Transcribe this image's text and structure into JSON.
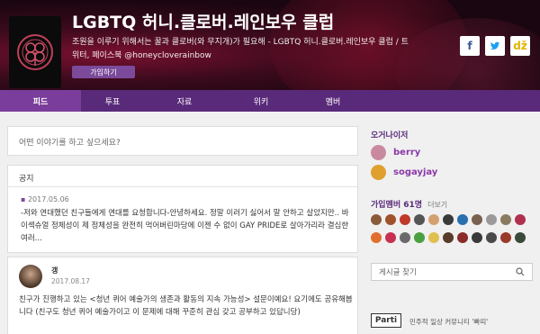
{
  "header": {
    "title": "LGBTQ 허니.클로버.레인보우 클럽",
    "description": "조원을 이루기 위해서는 꿀과 클로버(와 무지개)가 필요해 - LGBTQ 허니.클로버.레인보우 클럽 / 트위터, 페이스북 @honeycloverainbow",
    "join_label": "가입하기",
    "share_buttons": [
      {
        "name": "facebook",
        "glyph": "f"
      },
      {
        "name": "twitter",
        "glyph": "t"
      },
      {
        "name": "kakaostory",
        "glyph": "ǆ"
      }
    ]
  },
  "tabs": [
    {
      "label": "피드",
      "active": true
    },
    {
      "label": "투표",
      "active": false
    },
    {
      "label": "자료",
      "active": false
    },
    {
      "label": "위키",
      "active": false
    },
    {
      "label": "멤버",
      "active": false
    }
  ],
  "compose": {
    "placeholder": "어떤 이야기를 하고 싶으세요?"
  },
  "notice": {
    "heading": "공지",
    "date": "2017.05.06",
    "text": "-저와 연대했던 친구들에게 연대를 요청합니다-안녕하세요. 정말 이러기 싫어서 말 안하고 살았지만.. 바이섹슈얼 정체성이 제 정체성을 완전히 먹어버린마당에 이젠 수 없이 GAY PRIDE로 살아가리라 결심한 여러..."
  },
  "post": {
    "author": "갱",
    "date": "2017.08.17",
    "text": "친구가 진행하고 있는 <청년 퀴어 예술가의 생존과 활동의 지속 가능성> 설문이예요! 요기에도 공유해봅니다 (친구도 청년 퀴어 예술가이고 이 문제에 대해 꾸준히 관심 갖고 공부하고 있답니당)"
  },
  "sidebar": {
    "organizers_label": "오거나이저",
    "organizers": [
      {
        "name": "berry",
        "color": "#c98aa0"
      },
      {
        "name": "sogayjay",
        "color": "#e0a030"
      }
    ],
    "members_label": "가입멤버 61명",
    "members_more": "더보기",
    "member_colors": [
      "#8a5a3a",
      "#a0522d",
      "#c0392b",
      "#555555",
      "#d4a070",
      "#3a3a3a",
      "#2a6fb0",
      "#7a6050",
      "#9a9a9a",
      "#8a7a60",
      "#b03050",
      "#e07030",
      "#c83050",
      "#6a6a6a",
      "#4aa040",
      "#e0c050",
      "#5a3a2a",
      "#8a2a2a",
      "#3a3a3a",
      "#4a4a4a",
      "#9a3a2a",
      "#3a4a3a"
    ],
    "search_placeholder": "게시글 찾기",
    "partner_logo": "Parti",
    "partner_text": "민주적 일상 커뮤니티 '빠띠'"
  },
  "colors": {
    "accent": "#5a2a7a",
    "active_tab": "#7b3d9b",
    "join_button": "#7b4a9a"
  }
}
